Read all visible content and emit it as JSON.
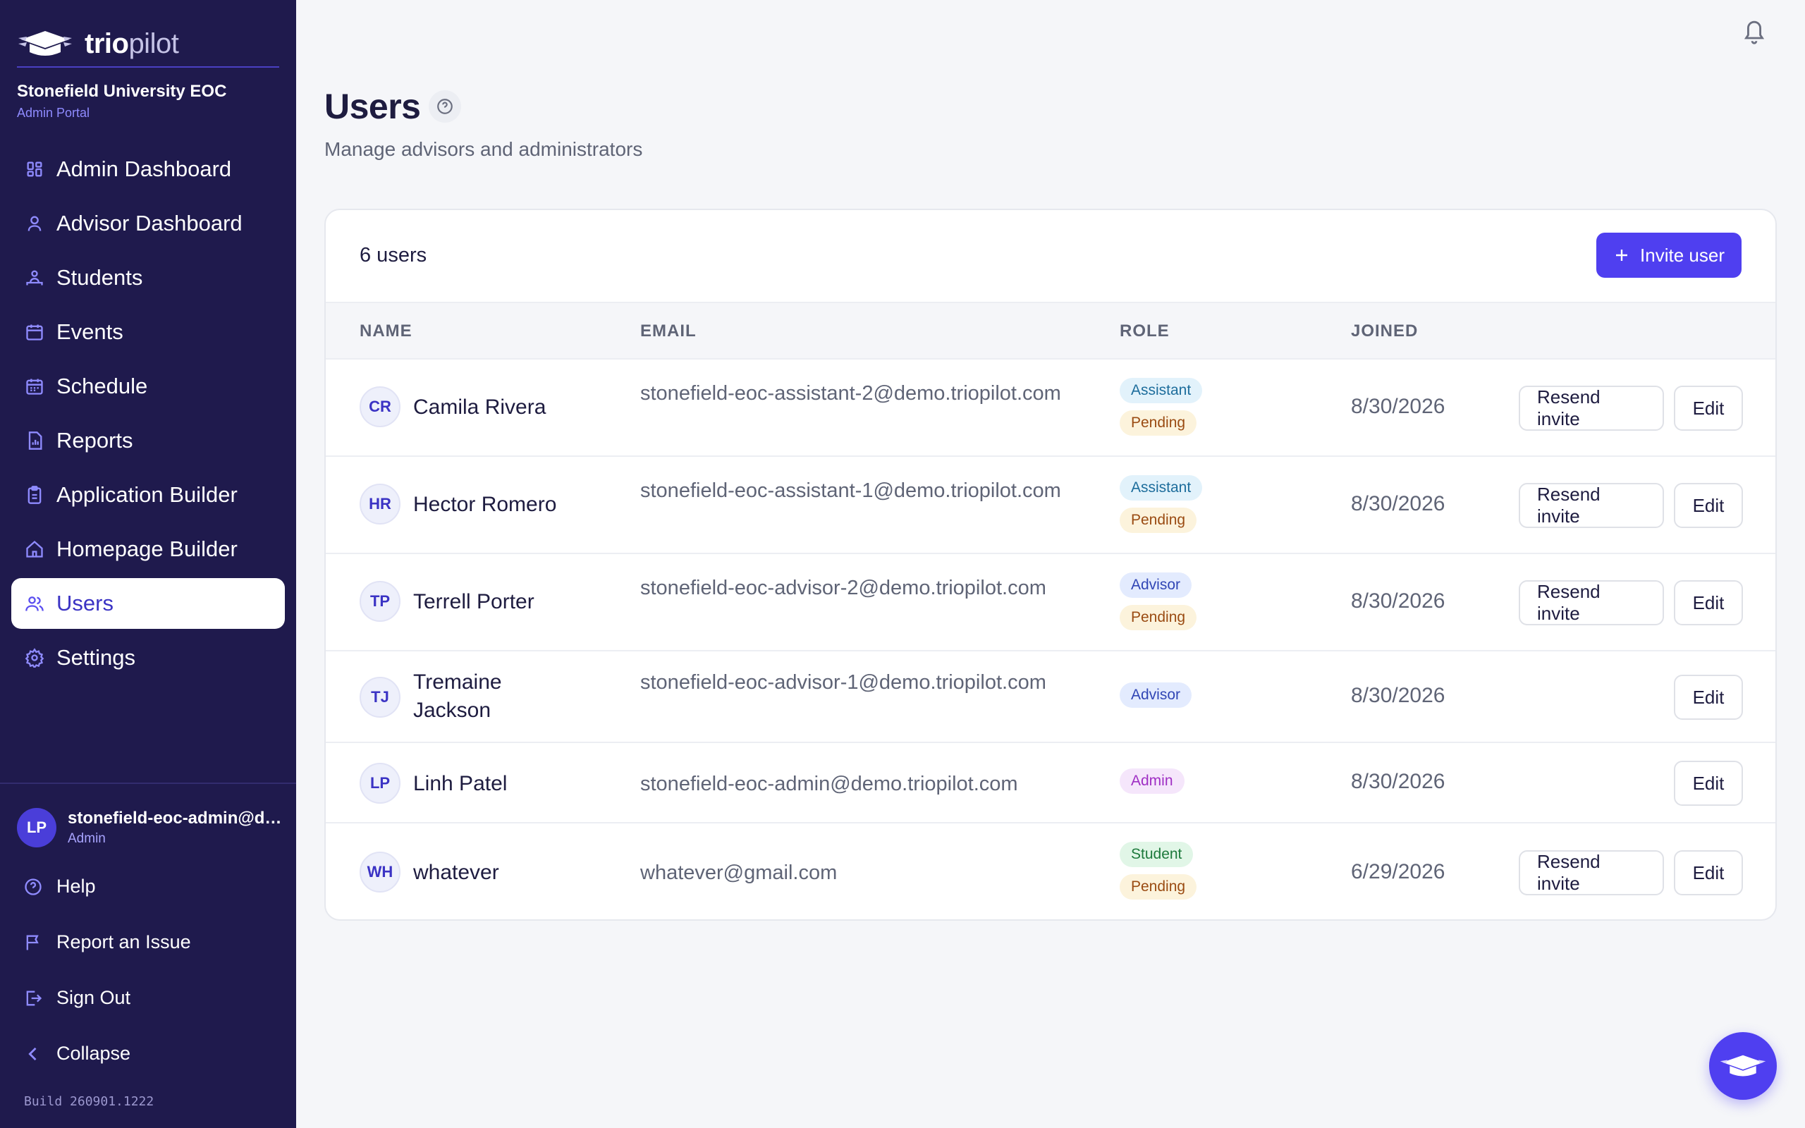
{
  "brand": {
    "name_bold": "trio",
    "name_light": "pilot",
    "org_name": "Stonefield University EOC",
    "org_sub": "Admin Portal"
  },
  "nav": [
    {
      "label": "Admin Dashboard",
      "icon": "grid-icon",
      "active": false
    },
    {
      "label": "Advisor Dashboard",
      "icon": "person-icon",
      "active": false
    },
    {
      "label": "Students",
      "icon": "students-icon",
      "active": false
    },
    {
      "label": "Events",
      "icon": "calendar-icon",
      "active": false
    },
    {
      "label": "Schedule",
      "icon": "calendar-clock-icon",
      "active": false
    },
    {
      "label": "Reports",
      "icon": "report-icon",
      "active": false
    },
    {
      "label": "Application Builder",
      "icon": "clipboard-icon",
      "active": false
    },
    {
      "label": "Homepage Builder",
      "icon": "home-icon",
      "active": false
    },
    {
      "label": "Users",
      "icon": "users-icon",
      "active": true
    },
    {
      "label": "Settings",
      "icon": "gear-icon",
      "active": false
    }
  ],
  "account": {
    "initials": "LP",
    "email": "stonefield-eoc-admin@demo.triopilot.com",
    "role": "Admin"
  },
  "bottom_links": {
    "help": "Help",
    "report": "Report an Issue",
    "signout": "Sign Out",
    "collapse": "Collapse"
  },
  "build": "Build 260901.1222",
  "page": {
    "title": "Users",
    "subtitle": "Manage advisors and administrators"
  },
  "card": {
    "count": "6 users",
    "invite_label": "Invite user"
  },
  "table": {
    "headers": [
      "NAME",
      "EMAIL",
      "ROLE",
      "JOINED"
    ],
    "rows": [
      {
        "initials": "CR",
        "name": "Camila Rivera",
        "email": "stonefield-eoc-assistant-2@demo.triopilot.com",
        "role": "Assistant",
        "role_class": "b-assistant",
        "pending": "Pending",
        "joined": "8/30/2026",
        "resend": "Resend invite",
        "edit": "Edit"
      },
      {
        "initials": "HR",
        "name": "Hector Romero",
        "email": "stonefield-eoc-assistant-1@demo.triopilot.com",
        "role": "Assistant",
        "role_class": "b-assistant",
        "pending": "Pending",
        "joined": "8/30/2026",
        "resend": "Resend invite",
        "edit": "Edit"
      },
      {
        "initials": "TP",
        "name": "Terrell Porter",
        "email": "stonefield-eoc-advisor-2@demo.triopilot.com",
        "role": "Advisor",
        "role_class": "b-advisor",
        "pending": "Pending",
        "joined": "8/30/2026",
        "resend": "Resend invite",
        "edit": "Edit"
      },
      {
        "initials": "TJ",
        "name": "Tremaine Jackson",
        "email": "stonefield-eoc-advisor-1@demo.triopilot.com",
        "role": "Advisor",
        "role_class": "b-advisor",
        "pending": null,
        "joined": "8/30/2026",
        "resend": null,
        "edit": "Edit"
      },
      {
        "initials": "LP",
        "name": "Linh Patel",
        "email": "stonefield-eoc-admin@demo.triopilot.com",
        "role": "Admin",
        "role_class": "b-admin",
        "pending": null,
        "joined": "8/30/2026",
        "resend": null,
        "edit": "Edit"
      },
      {
        "initials": "WH",
        "name": "whatever",
        "email": "whatever@gmail.com",
        "role": "Student",
        "role_class": "b-student",
        "pending": "Pending",
        "joined": "6/29/2026",
        "resend": "Resend invite",
        "edit": "Edit"
      }
    ]
  },
  "colors": {
    "sidebar": "#1f1a4d",
    "accent": "#4f3ff0",
    "page_bg": "#f5f6f9"
  }
}
